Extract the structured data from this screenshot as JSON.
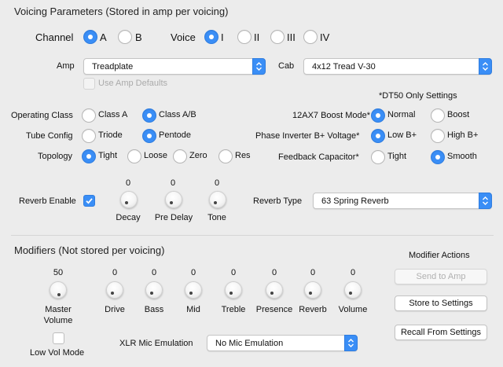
{
  "voicing": {
    "title": "Voicing Parameters (Stored in amp per voicing)",
    "channel_label": "Channel",
    "channel_options": [
      "A",
      "B"
    ],
    "voice_label": "Voice",
    "voice_options": [
      "I",
      "II",
      "III",
      "IV"
    ],
    "amp_label": "Amp",
    "amp_value": "Treadplate",
    "cab_label": "Cab",
    "cab_value": "4x12 Tread V-30",
    "use_amp_defaults": "Use Amp Defaults",
    "dt50_note": "*DT50 Only Settings",
    "operating_class_label": "Operating Class",
    "operating_class_options": [
      "Class A",
      "Class A/B"
    ],
    "tube_config_label": "Tube Config",
    "tube_config_options": [
      "Triode",
      "Pentode"
    ],
    "topology_label": "Topology",
    "topology_options": [
      "Tight",
      "Loose",
      "Zero",
      "Res"
    ],
    "boost_mode_label": "12AX7 Boost Mode*",
    "boost_mode_options": [
      "Normal",
      "Boost"
    ],
    "phase_inverter_label": "Phase Inverter B+ Voltage*",
    "phase_inverter_options": [
      "Low B+",
      "High B+"
    ],
    "feedback_label": "Feedback Capacitor*",
    "feedback_options": [
      "Tight",
      "Smooth"
    ],
    "reverb_enable_label": "Reverb Enable",
    "reverb_knobs": [
      {
        "label": "Decay",
        "value": "0"
      },
      {
        "label": "Pre Delay",
        "value": "0"
      },
      {
        "label": "Tone",
        "value": "0"
      }
    ],
    "reverb_type_label": "Reverb Type",
    "reverb_type_value": "63 Spring Reverb"
  },
  "modifiers": {
    "title": "Modifiers (Not stored per voicing)",
    "master": {
      "label_line1": "Master",
      "label_line2": "Volume",
      "value": "50"
    },
    "knobs": [
      {
        "label": "Drive",
        "value": "0"
      },
      {
        "label": "Bass",
        "value": "0"
      },
      {
        "label": "Mid",
        "value": "0"
      },
      {
        "label": "Treble",
        "value": "0"
      },
      {
        "label": "Presence",
        "value": "0"
      },
      {
        "label": "Reverb",
        "value": "0"
      },
      {
        "label": "Volume",
        "value": "0"
      }
    ],
    "low_vol_label": "Low Vol Mode",
    "xlr_label": "XLR Mic Emulation",
    "xlr_value": "No Mic Emulation",
    "actions_title": "Modifier Actions",
    "send_button": "Send to Amp",
    "store_button": "Store to Settings",
    "recall_button": "Recall From Settings"
  },
  "colors": {
    "accent": "#3a8ef6",
    "background": "#ececec"
  }
}
